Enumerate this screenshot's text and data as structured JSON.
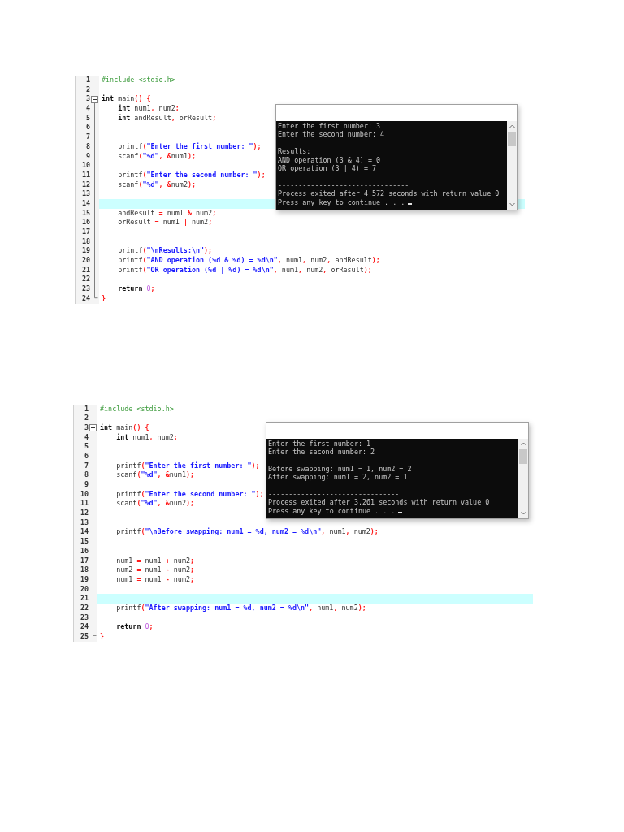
{
  "panels": [
    {
      "editor": {
        "lines": [
          {
            "number": "1",
            "kind": "line",
            "highlighted": false,
            "tokens": [
              {
                "kind": "pre",
                "text": "#include <stdio.h>"
              }
            ]
          },
          {
            "number": "2",
            "kind": "line",
            "highlighted": false
          },
          {
            "number": "3",
            "kind": "opener",
            "highlighted": false,
            "tokens": [
              {
                "kind": "kw",
                "text": "int"
              },
              {
                "kind": "plain",
                "text": " main"
              },
              {
                "kind": "sym",
                "text": "() {"
              }
            ]
          },
          {
            "number": "4",
            "kind": "line",
            "highlighted": false,
            "tokens": [
              {
                "kind": "kw",
                "text": "    int"
              },
              {
                "kind": "plain",
                "text": " num1"
              },
              {
                "kind": "sym",
                "text": ","
              },
              {
                "kind": "plain",
                "text": " num2"
              },
              {
                "kind": "sym",
                "text": ";"
              }
            ]
          },
          {
            "number": "5",
            "kind": "line",
            "highlighted": false,
            "tokens": [
              {
                "kind": "kw",
                "text": "    int"
              },
              {
                "kind": "plain",
                "text": " andResult"
              },
              {
                "kind": "sym",
                "text": ","
              },
              {
                "kind": "plain",
                "text": " orResult"
              },
              {
                "kind": "sym",
                "text": ";"
              }
            ]
          },
          {
            "number": "6",
            "kind": "line",
            "highlighted": false
          },
          {
            "number": "7",
            "kind": "line",
            "highlighted": false
          },
          {
            "number": "8",
            "kind": "line",
            "highlighted": false,
            "tokens": [
              {
                "kind": "plain",
                "text": "    printf"
              },
              {
                "kind": "sym",
                "text": "("
              },
              {
                "kind": "str",
                "text": "\"Enter the first number: \""
              },
              {
                "kind": "sym",
                "text": ");"
              }
            ]
          },
          {
            "number": "9",
            "kind": "line",
            "highlighted": false,
            "tokens": [
              {
                "kind": "plain",
                "text": "    scanf"
              },
              {
                "kind": "sym",
                "text": "("
              },
              {
                "kind": "str",
                "text": "\"%d\""
              },
              {
                "kind": "sym",
                "text": ", &"
              },
              {
                "kind": "plain",
                "text": "num1"
              },
              {
                "kind": "sym",
                "text": ");"
              }
            ]
          },
          {
            "number": "10",
            "kind": "line",
            "highlighted": false
          },
          {
            "number": "11",
            "kind": "line",
            "highlighted": false,
            "tokens": [
              {
                "kind": "plain",
                "text": "    printf"
              },
              {
                "kind": "sym",
                "text": "("
              },
              {
                "kind": "str",
                "text": "\"Enter the second number: \""
              },
              {
                "kind": "sym",
                "text": ");"
              }
            ]
          },
          {
            "number": "12",
            "kind": "line",
            "highlighted": false,
            "tokens": [
              {
                "kind": "plain",
                "text": "    scanf"
              },
              {
                "kind": "sym",
                "text": "("
              },
              {
                "kind": "str",
                "text": "\"%d\""
              },
              {
                "kind": "sym",
                "text": ", &"
              },
              {
                "kind": "plain",
                "text": "num2"
              },
              {
                "kind": "sym",
                "text": ");"
              }
            ]
          },
          {
            "number": "13",
            "kind": "line",
            "highlighted": false
          },
          {
            "number": "14",
            "kind": "line",
            "highlighted": true
          },
          {
            "number": "15",
            "kind": "line",
            "highlighted": false,
            "tokens": [
              {
                "kind": "plain",
                "text": "    andResult "
              },
              {
                "kind": "sym",
                "text": "="
              },
              {
                "kind": "plain",
                "text": " num1 "
              },
              {
                "kind": "sym",
                "text": "&"
              },
              {
                "kind": "plain",
                "text": " num2"
              },
              {
                "kind": "sym",
                "text": ";"
              }
            ]
          },
          {
            "number": "16",
            "kind": "line",
            "highlighted": false,
            "tokens": [
              {
                "kind": "plain",
                "text": "    orResult "
              },
              {
                "kind": "sym",
                "text": "="
              },
              {
                "kind": "plain",
                "text": " num1 "
              },
              {
                "kind": "sym",
                "text": "|"
              },
              {
                "kind": "plain",
                "text": " num2"
              },
              {
                "kind": "sym",
                "text": ";"
              }
            ]
          },
          {
            "number": "17",
            "kind": "line",
            "highlighted": false
          },
          {
            "number": "18",
            "kind": "line",
            "highlighted": false
          },
          {
            "number": "19",
            "kind": "line",
            "highlighted": false,
            "tokens": [
              {
                "kind": "plain",
                "text": "    printf"
              },
              {
                "kind": "sym",
                "text": "("
              },
              {
                "kind": "str",
                "text": "\"\\nResults:\\n\""
              },
              {
                "kind": "sym",
                "text": ");"
              }
            ]
          },
          {
            "number": "20",
            "kind": "line",
            "highlighted": false,
            "tokens": [
              {
                "kind": "plain",
                "text": "    printf"
              },
              {
                "kind": "sym",
                "text": "("
              },
              {
                "kind": "str",
                "text": "\"AND operation (%d & %d) = %d\\n\""
              },
              {
                "kind": "sym",
                "text": ","
              },
              {
                "kind": "plain",
                "text": " num1"
              },
              {
                "kind": "sym",
                "text": ","
              },
              {
                "kind": "plain",
                "text": " num2"
              },
              {
                "kind": "sym",
                "text": ","
              },
              {
                "kind": "plain",
                "text": " andResult"
              },
              {
                "kind": "sym",
                "text": ");"
              }
            ]
          },
          {
            "number": "21",
            "kind": "line",
            "highlighted": false,
            "tokens": [
              {
                "kind": "plain",
                "text": "    printf"
              },
              {
                "kind": "sym",
                "text": "("
              },
              {
                "kind": "str",
                "text": "\"OR operation (%d | %d) = %d\\n\""
              },
              {
                "kind": "sym",
                "text": ","
              },
              {
                "kind": "plain",
                "text": " num1"
              },
              {
                "kind": "sym",
                "text": ","
              },
              {
                "kind": "plain",
                "text": " num2"
              },
              {
                "kind": "sym",
                "text": ","
              },
              {
                "kind": "plain",
                "text": " orResult"
              },
              {
                "kind": "sym",
                "text": ");"
              }
            ]
          },
          {
            "number": "22",
            "kind": "line",
            "highlighted": false
          },
          {
            "number": "23",
            "kind": "line",
            "highlighted": false,
            "tokens": [
              {
                "kind": "kw",
                "text": "    return"
              },
              {
                "kind": "num",
                "text": " 0"
              },
              {
                "kind": "sym",
                "text": ";"
              }
            ]
          },
          {
            "number": "24",
            "kind": "closer",
            "highlighted": false,
            "tokens": [
              {
                "kind": "sym",
                "text": "}"
              }
            ]
          }
        ]
      },
      "console": {
        "blocks": [
          [
            "Enter the first number: 3",
            "Enter the second number: 4"
          ],
          [
            "Results:",
            "AND operation (3 & 4) = 0",
            "OR operation (3 | 4) = 7"
          ],
          [
            "--------------------------------",
            "Process exited after 4.572 seconds with return value 0",
            "Press any key to continue . . ."
          ]
        ]
      }
    },
    {
      "editor": {
        "lines": [
          {
            "number": "1",
            "kind": "line",
            "highlighted": false,
            "tokens": [
              {
                "kind": "pre",
                "text": "#include <stdio.h>"
              }
            ]
          },
          {
            "number": "2",
            "kind": "line",
            "highlighted": false
          },
          {
            "number": "3",
            "kind": "opener",
            "highlighted": false,
            "tokens": [
              {
                "kind": "kw",
                "text": "int"
              },
              {
                "kind": "plain",
                "text": " main"
              },
              {
                "kind": "sym",
                "text": "() {"
              }
            ]
          },
          {
            "number": "4",
            "kind": "line",
            "highlighted": false,
            "tokens": [
              {
                "kind": "kw",
                "text": "    int"
              },
              {
                "kind": "plain",
                "text": " num1"
              },
              {
                "kind": "sym",
                "text": ","
              },
              {
                "kind": "plain",
                "text": " num2"
              },
              {
                "kind": "sym",
                "text": ";"
              }
            ]
          },
          {
            "number": "5",
            "kind": "line",
            "highlighted": false
          },
          {
            "number": "6",
            "kind": "line",
            "highlighted": false
          },
          {
            "number": "7",
            "kind": "line",
            "highlighted": false,
            "tokens": [
              {
                "kind": "plain",
                "text": "    printf"
              },
              {
                "kind": "sym",
                "text": "("
              },
              {
                "kind": "str",
                "text": "\"Enter the first number: \""
              },
              {
                "kind": "sym",
                "text": ");"
              }
            ]
          },
          {
            "number": "8",
            "kind": "line",
            "highlighted": false,
            "tokens": [
              {
                "kind": "plain",
                "text": "    scanf"
              },
              {
                "kind": "sym",
                "text": "("
              },
              {
                "kind": "str",
                "text": "\"%d\""
              },
              {
                "kind": "sym",
                "text": ", &"
              },
              {
                "kind": "plain",
                "text": "num1"
              },
              {
                "kind": "sym",
                "text": ");"
              }
            ]
          },
          {
            "number": "9",
            "kind": "line",
            "highlighted": false
          },
          {
            "number": "10",
            "kind": "line",
            "highlighted": false,
            "tokens": [
              {
                "kind": "plain",
                "text": "    printf"
              },
              {
                "kind": "sym",
                "text": "("
              },
              {
                "kind": "str",
                "text": "\"Enter the second number: \""
              },
              {
                "kind": "sym",
                "text": ");"
              }
            ]
          },
          {
            "number": "11",
            "kind": "line",
            "highlighted": false,
            "tokens": [
              {
                "kind": "plain",
                "text": "    scanf"
              },
              {
                "kind": "sym",
                "text": "("
              },
              {
                "kind": "str",
                "text": "\"%d\""
              },
              {
                "kind": "sym",
                "text": ", &"
              },
              {
                "kind": "plain",
                "text": "num2"
              },
              {
                "kind": "sym",
                "text": ");"
              }
            ]
          },
          {
            "number": "12",
            "kind": "line",
            "highlighted": false
          },
          {
            "number": "13",
            "kind": "line",
            "highlighted": false
          },
          {
            "number": "14",
            "kind": "line",
            "highlighted": false,
            "tokens": [
              {
                "kind": "plain",
                "text": "    printf"
              },
              {
                "kind": "sym",
                "text": "("
              },
              {
                "kind": "str",
                "text": "\"\\nBefore swapping: num1 = %d, num2 = %d\\n\""
              },
              {
                "kind": "sym",
                "text": ","
              },
              {
                "kind": "plain",
                "text": " num1"
              },
              {
                "kind": "sym",
                "text": ","
              },
              {
                "kind": "plain",
                "text": " num2"
              },
              {
                "kind": "sym",
                "text": ");"
              }
            ]
          },
          {
            "number": "15",
            "kind": "line",
            "highlighted": false
          },
          {
            "number": "16",
            "kind": "line",
            "highlighted": false
          },
          {
            "number": "17",
            "kind": "line",
            "highlighted": false,
            "tokens": [
              {
                "kind": "plain",
                "text": "    num1 "
              },
              {
                "kind": "sym",
                "text": "="
              },
              {
                "kind": "plain",
                "text": " num1 "
              },
              {
                "kind": "sym",
                "text": "+"
              },
              {
                "kind": "plain",
                "text": " num2"
              },
              {
                "kind": "sym",
                "text": ";"
              }
            ]
          },
          {
            "number": "18",
            "kind": "line",
            "highlighted": false,
            "tokens": [
              {
                "kind": "plain",
                "text": "    num2 "
              },
              {
                "kind": "sym",
                "text": "="
              },
              {
                "kind": "plain",
                "text": " num1 "
              },
              {
                "kind": "sym",
                "text": "-"
              },
              {
                "kind": "plain",
                "text": " num2"
              },
              {
                "kind": "sym",
                "text": ";"
              }
            ]
          },
          {
            "number": "19",
            "kind": "line",
            "highlighted": false,
            "tokens": [
              {
                "kind": "plain",
                "text": "    num1 "
              },
              {
                "kind": "sym",
                "text": "="
              },
              {
                "kind": "plain",
                "text": " num1 "
              },
              {
                "kind": "sym",
                "text": "-"
              },
              {
                "kind": "plain",
                "text": " num2"
              },
              {
                "kind": "sym",
                "text": ";"
              }
            ]
          },
          {
            "number": "20",
            "kind": "line",
            "highlighted": false
          },
          {
            "number": "21",
            "kind": "line",
            "highlighted": true
          },
          {
            "number": "22",
            "kind": "line",
            "highlighted": false,
            "tokens": [
              {
                "kind": "plain",
                "text": "    printf"
              },
              {
                "kind": "sym",
                "text": "("
              },
              {
                "kind": "str",
                "text": "\"After swapping: num1 = %d, num2 = %d\\n\""
              },
              {
                "kind": "sym",
                "text": ","
              },
              {
                "kind": "plain",
                "text": " num1"
              },
              {
                "kind": "sym",
                "text": ","
              },
              {
                "kind": "plain",
                "text": " num2"
              },
              {
                "kind": "sym",
                "text": ");"
              }
            ]
          },
          {
            "number": "23",
            "kind": "line",
            "highlighted": false
          },
          {
            "number": "24",
            "kind": "line",
            "highlighted": false,
            "tokens": [
              {
                "kind": "kw",
                "text": "    return"
              },
              {
                "kind": "num",
                "text": " 0"
              },
              {
                "kind": "sym",
                "text": ";"
              }
            ]
          },
          {
            "number": "25",
            "kind": "closer",
            "highlighted": false,
            "tokens": [
              {
                "kind": "sym",
                "text": "}"
              }
            ]
          }
        ]
      },
      "console": {
        "blocks": [
          [
            "Enter the first number: 1",
            "Enter the second number: 2"
          ],
          [
            "Before swapping: num1 = 1, num2 = 2",
            "After swapping: num1 = 2, num2 = 1"
          ],
          [
            "--------------------------------",
            "Process exited after 3.261 seconds with return value 0",
            "Press any key to continue . . ."
          ]
        ]
      }
    }
  ]
}
